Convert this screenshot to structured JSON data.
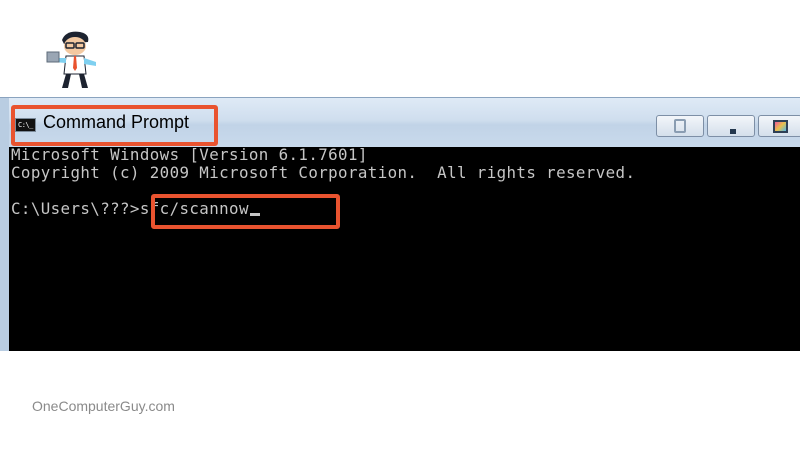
{
  "logo": {
    "icon": "developer-mascot"
  },
  "window": {
    "title": "Command Prompt",
    "icon_label": "C:\\_",
    "controls": [
      "pin",
      "minimize",
      "maximize",
      "close"
    ]
  },
  "console": {
    "lines": [
      "Microsoft Windows [Version 6.1.7601]",
      "Copyright (c) 2009 Microsoft Corporation.  All rights reserved."
    ],
    "prompt": "C:\\Users\\???>",
    "command": "sfc/scannow"
  },
  "watermark": "OneComputerGuy.com",
  "colors": {
    "highlight": "#e9532f",
    "console_bg": "#000000",
    "console_text": "#c6c6c6"
  }
}
